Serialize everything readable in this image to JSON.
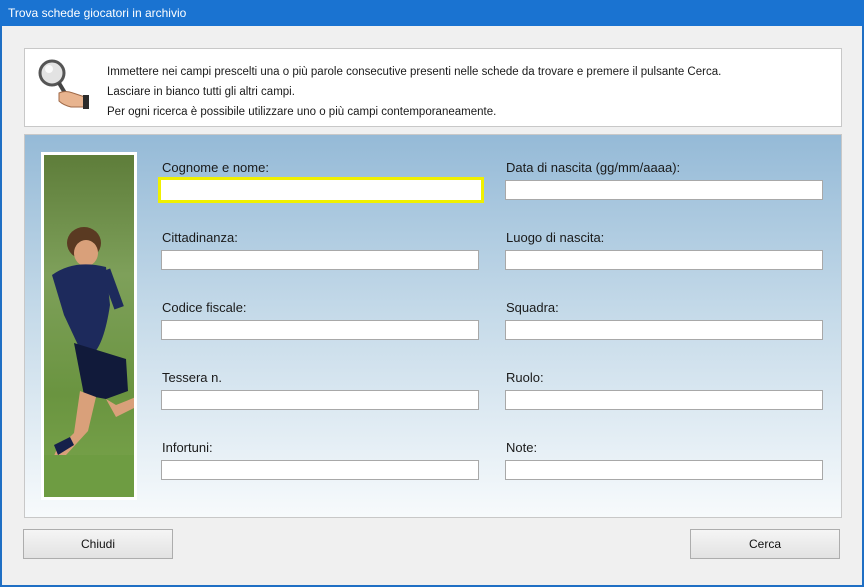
{
  "window": {
    "title": "Trova schede giocatori in archivio"
  },
  "info": {
    "icon": "magnifier-hand-icon",
    "lines": [
      "Immettere nei campi prescelti una o più parole consecutive presenti nelle schede da trovare e premere il pulsante Cerca.",
      "Lasciare in bianco tutti gli altri campi.",
      "Per ogni ricerca è possibile utilizzare uno o più campi contemporaneamente."
    ]
  },
  "fields": {
    "cognome_nome": {
      "label": "Cognome e nome:",
      "value": ""
    },
    "data_nascita": {
      "label": "Data di nascita (gg/mm/aaaa):",
      "value": ""
    },
    "cittadinanza": {
      "label": "Cittadinanza:",
      "value": ""
    },
    "luogo_nascita": {
      "label": "Luogo di nascita:",
      "value": ""
    },
    "codice_fiscale": {
      "label": "Codice fiscale:",
      "value": ""
    },
    "squadra": {
      "label": "Squadra:",
      "value": ""
    },
    "tessera": {
      "label": "Tessera n.",
      "value": ""
    },
    "ruolo": {
      "label": "Ruolo:",
      "value": ""
    },
    "infortuni": {
      "label": "Infortuni:",
      "value": ""
    },
    "note": {
      "label": "Note:",
      "value": ""
    }
  },
  "buttons": {
    "close": "Chiudi",
    "search": "Cerca"
  },
  "colors": {
    "titlebar": "#1a73d1",
    "focus_border": "#f0f000",
    "form_gradient_top": "#95bad7"
  }
}
